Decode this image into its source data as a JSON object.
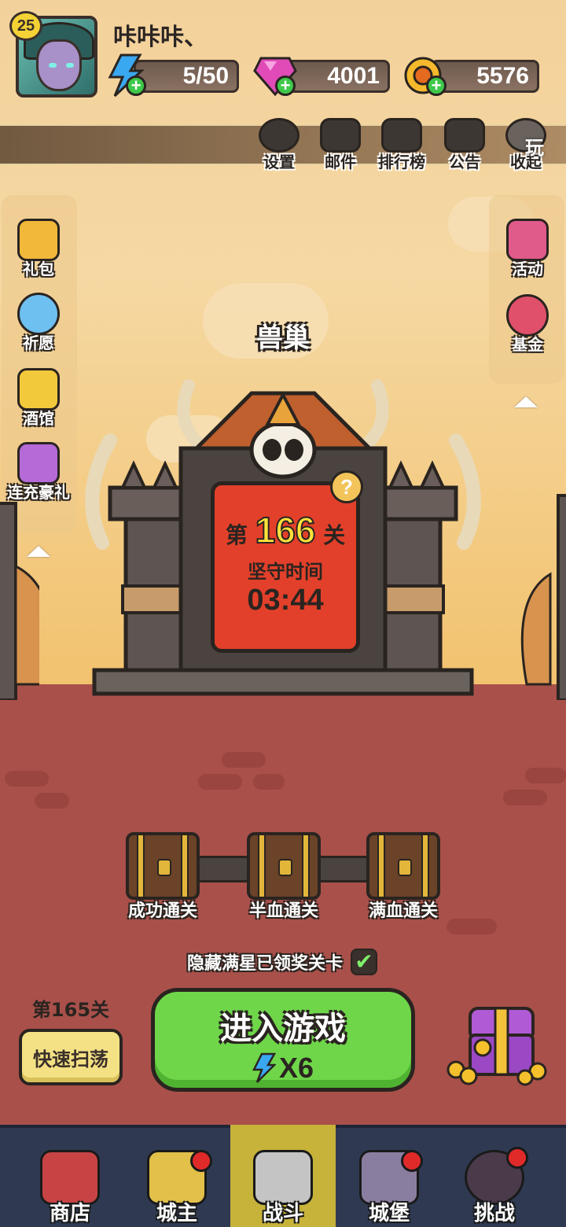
{
  "player": {
    "level": "25",
    "name": "咔咔咔、"
  },
  "resources": {
    "energy": "5/50",
    "gems": "4001",
    "gold": "5576"
  },
  "top_menu": [
    {
      "label": "设置",
      "icon": "gear-icon"
    },
    {
      "label": "邮件",
      "icon": "mail-icon"
    },
    {
      "label": "排行榜",
      "icon": "leaderboard-icon"
    },
    {
      "label": "公告",
      "icon": "megaphone-icon"
    },
    {
      "label": "收起",
      "icon": "collapse-icon"
    }
  ],
  "top_menu_extra": "玩",
  "left_panel": [
    {
      "label": "礼包",
      "icon": "gift-icon"
    },
    {
      "label": "祈愿",
      "icon": "wish-orb-icon"
    },
    {
      "label": "酒馆",
      "icon": "beer-mug-icon"
    },
    {
      "label": "连充豪礼",
      "icon": "gift-box-icon"
    }
  ],
  "right_panel": [
    {
      "label": "活动",
      "icon": "event-icon"
    },
    {
      "label": "基金",
      "icon": "money-bag-icon"
    }
  ],
  "area_name": "兽巢",
  "stage": {
    "prefix": "第",
    "number": "166",
    "suffix": "关",
    "guard_label": "坚守时间",
    "guard_time": "03:44",
    "help": "?"
  },
  "chests": [
    {
      "label": "成功通关"
    },
    {
      "label": "半血通关"
    },
    {
      "label": "满血通关"
    }
  ],
  "hide_cleared_label": "隐藏满星已领奖关卡",
  "hide_cleared_checked": "✔",
  "prev_stage": "第165关",
  "quick_sweep": "快速扫荡",
  "enter_game": {
    "label": "进入游戏",
    "cost": "X6"
  },
  "bottom_nav": [
    {
      "label": "商店",
      "icon": "shop-icon"
    },
    {
      "label": "城主",
      "icon": "crown-icon"
    },
    {
      "label": "战斗",
      "icon": "crossed-swords-icon"
    },
    {
      "label": "城堡",
      "icon": "castle-icon"
    },
    {
      "label": "挑战",
      "icon": "demon-icon"
    }
  ],
  "colors": {
    "sky": "#f3d19b",
    "ground": "#a9504a",
    "sign": "#e2402a",
    "enter_button": "#6fd64a",
    "nav_bg": "#2f3a52",
    "nav_active": "#c7b23a"
  }
}
